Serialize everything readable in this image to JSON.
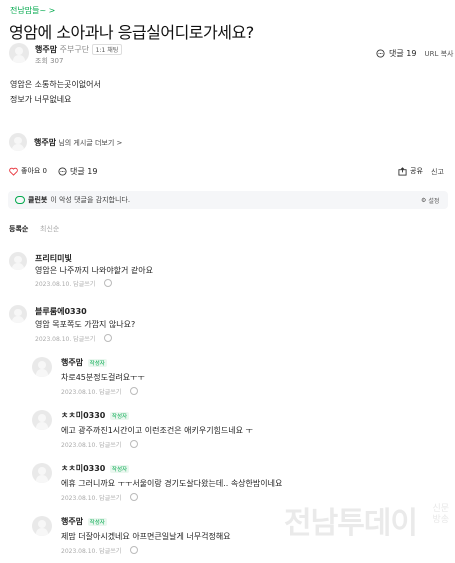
{
  "post": {
    "board_link": "전남맘들~ >",
    "title": "영암에 소아과나 응급실어디로가세요?",
    "author": "행주맘",
    "author_grade": "주부구단",
    "chat_label": "1:1 채팅",
    "view_label": "조회 307",
    "comment_label": "댓글 19",
    "url_copy": "URL 복사",
    "body_line1": "영암은 소통하는곳이없어서",
    "body_line2": "정보가 너무없네요",
    "profile_link": "님의 게시글 더보기 >",
    "profile_name": "행주맘",
    "like_label": "좋아요 0",
    "comments_count_label": "댓글 19",
    "share_label": "공유",
    "report_label": "신고"
  },
  "cleanbot": {
    "label": "클린봇",
    "text": "이 악성 댓글을 감지합니다.",
    "settings": "설정"
  },
  "sort": {
    "register": "등록순",
    "latest": "최신순"
  },
  "comments": [
    {
      "name": "프리티미빛",
      "text": "영암은 나주까지 나와야할거 같아요",
      "meta": "2023.08.10. 답글쓰기",
      "writer": false
    },
    {
      "name": "블루룸에0330",
      "text": "영암 목포쪽도 가깝지 않나요?",
      "meta": "2023.08.10. 답글쓰기",
      "writer": false
    },
    {
      "name": "행주맘",
      "text": "차로45분정도걸려요ㅜㅜ",
      "meta": "2023.08.10. 답글쓰기",
      "writer": true
    },
    {
      "name": "ㅊㅊ미0330",
      "text": "에고 광주까진1시간이고 이런조건은 애키우기힘드네요 ㅜ",
      "meta": "2023.08.10. 답글쓰기",
      "writer": true
    },
    {
      "name": "ㅊㅊ미0330",
      "text": "에휴 그러니까요 ㅜㅜ서울이랑 경기도살다왔는데.. 속상한밤이네요",
      "meta": "2023.08.10. 답글쓰기",
      "writer": true
    },
    {
      "name": "행주맘",
      "text": "제맘 더잘아시겠네요 아프면큰일날게 너무걱정해요",
      "meta": "2023.08.10. 답글쓰기",
      "writer": true
    }
  ],
  "writer_badge": "작성자",
  "watermark": {
    "main": "전남투데이",
    "side_line1": "신문",
    "side_line2": "방송"
  },
  "colors": {
    "accent_green": "#03a94d",
    "heart_red": "#e8333b"
  }
}
